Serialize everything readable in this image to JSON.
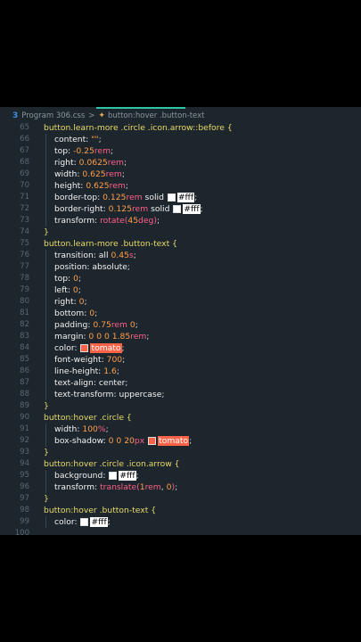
{
  "breadcrumb": {
    "file": "Program 306.css",
    "selector": "button:hover .button-text",
    "separator": ">"
  },
  "colors": {
    "white": "#ffffff",
    "tomato": "#ff6347"
  },
  "lines": [
    {
      "n": "65",
      "segs": [
        {
          "c": "sel",
          "t": "button.learn-more .circle .icon.arrow::before "
        },
        {
          "c": "brace",
          "t": "{"
        }
      ]
    },
    {
      "n": "66",
      "ind": 1,
      "segs": [
        {
          "c": "prop",
          "t": "content: "
        },
        {
          "c": "num",
          "t": "\"\""
        },
        {
          "c": "punc",
          "t": ";"
        }
      ]
    },
    {
      "n": "67",
      "ind": 1,
      "segs": [
        {
          "c": "prop",
          "t": "top: "
        },
        {
          "c": "num",
          "t": "-0.25"
        },
        {
          "c": "unit",
          "t": "rem"
        },
        {
          "c": "punc",
          "t": ";"
        }
      ]
    },
    {
      "n": "68",
      "ind": 1,
      "segs": [
        {
          "c": "prop",
          "t": "right: "
        },
        {
          "c": "num",
          "t": "0.0625"
        },
        {
          "c": "unit",
          "t": "rem"
        },
        {
          "c": "punc",
          "t": ";"
        }
      ]
    },
    {
      "n": "69",
      "ind": 1,
      "segs": [
        {
          "c": "prop",
          "t": "width: "
        },
        {
          "c": "num",
          "t": "0.625"
        },
        {
          "c": "unit",
          "t": "rem"
        },
        {
          "c": "punc",
          "t": ";"
        }
      ]
    },
    {
      "n": "70",
      "ind": 1,
      "segs": [
        {
          "c": "prop",
          "t": "height: "
        },
        {
          "c": "num",
          "t": "0.625"
        },
        {
          "c": "unit",
          "t": "rem"
        },
        {
          "c": "punc",
          "t": ";"
        }
      ]
    },
    {
      "n": "71",
      "ind": 1,
      "segs": [
        {
          "c": "prop",
          "t": "border-top: "
        },
        {
          "c": "num",
          "t": "0.125"
        },
        {
          "c": "unit",
          "t": "rem"
        },
        {
          "c": "kw",
          "t": " solid "
        },
        {
          "sw": "white"
        },
        {
          "c": "chip-white",
          "t": "#fff"
        },
        {
          "c": "punc",
          "t": ";"
        }
      ]
    },
    {
      "n": "72",
      "ind": 1,
      "segs": [
        {
          "c": "prop",
          "t": "border-right: "
        },
        {
          "c": "num",
          "t": "0.125"
        },
        {
          "c": "unit",
          "t": "rem"
        },
        {
          "c": "kw",
          "t": " solid "
        },
        {
          "sw": "white"
        },
        {
          "c": "chip-white",
          "t": "#fff"
        },
        {
          "c": "punc",
          "t": ";"
        }
      ]
    },
    {
      "n": "73",
      "ind": 1,
      "segs": [
        {
          "c": "prop",
          "t": "transform: "
        },
        {
          "c": "fn",
          "t": "rotate("
        },
        {
          "c": "num",
          "t": "45"
        },
        {
          "c": "unit",
          "t": "deg"
        },
        {
          "c": "fn",
          "t": ")"
        },
        {
          "c": "punc",
          "t": ";"
        }
      ]
    },
    {
      "n": "74",
      "segs": [
        {
          "c": "brace",
          "t": "}"
        }
      ]
    },
    {
      "n": "75",
      "segs": [
        {
          "c": "sel",
          "t": "button.learn-more .button-text "
        },
        {
          "c": "brace",
          "t": "{"
        }
      ]
    },
    {
      "n": "76",
      "ind": 1,
      "segs": [
        {
          "c": "prop",
          "t": "transition: "
        },
        {
          "c": "kw",
          "t": "all "
        },
        {
          "c": "num",
          "t": "0.45"
        },
        {
          "c": "unit",
          "t": "s"
        },
        {
          "c": "punc",
          "t": ";"
        }
      ]
    },
    {
      "n": "77",
      "ind": 1,
      "segs": [
        {
          "c": "prop",
          "t": "position: "
        },
        {
          "c": "kw",
          "t": "absolute"
        },
        {
          "c": "punc",
          "t": ";"
        }
      ]
    },
    {
      "n": "78",
      "ind": 1,
      "segs": [
        {
          "c": "prop",
          "t": "top: "
        },
        {
          "c": "num",
          "t": "0"
        },
        {
          "c": "punc",
          "t": ";"
        }
      ]
    },
    {
      "n": "79",
      "ind": 1,
      "segs": [
        {
          "c": "prop",
          "t": "left: "
        },
        {
          "c": "num",
          "t": "0"
        },
        {
          "c": "punc",
          "t": ";"
        }
      ]
    },
    {
      "n": "80",
      "ind": 1,
      "segs": [
        {
          "c": "prop",
          "t": "right: "
        },
        {
          "c": "num",
          "t": "0"
        },
        {
          "c": "punc",
          "t": ";"
        }
      ]
    },
    {
      "n": "81",
      "ind": 1,
      "segs": [
        {
          "c": "prop",
          "t": "bottom: "
        },
        {
          "c": "num",
          "t": "0"
        },
        {
          "c": "punc",
          "t": ";"
        }
      ]
    },
    {
      "n": "82",
      "ind": 1,
      "segs": [
        {
          "c": "prop",
          "t": "padding: "
        },
        {
          "c": "num",
          "t": "0.75"
        },
        {
          "c": "unit",
          "t": "rem"
        },
        {
          "c": "num",
          "t": " 0"
        },
        {
          "c": "punc",
          "t": ";"
        }
      ]
    },
    {
      "n": "83",
      "ind": 1,
      "segs": [
        {
          "c": "prop",
          "t": "margin: "
        },
        {
          "c": "num",
          "t": "0 0 0 1.85"
        },
        {
          "c": "unit",
          "t": "rem"
        },
        {
          "c": "punc",
          "t": ";"
        }
      ]
    },
    {
      "n": "84",
      "ind": 1,
      "segs": [
        {
          "c": "prop",
          "t": "color: "
        },
        {
          "sw": "tomato"
        },
        {
          "c": "chip-tomato",
          "t": "tomato"
        },
        {
          "c": "punc",
          "t": ";"
        }
      ]
    },
    {
      "n": "85",
      "ind": 1,
      "segs": [
        {
          "c": "prop",
          "t": "font-weight: "
        },
        {
          "c": "num",
          "t": "700"
        },
        {
          "c": "punc",
          "t": ";"
        }
      ]
    },
    {
      "n": "86",
      "ind": 1,
      "segs": [
        {
          "c": "prop",
          "t": "line-height: "
        },
        {
          "c": "num",
          "t": "1.6"
        },
        {
          "c": "punc",
          "t": ";"
        }
      ]
    },
    {
      "n": "87",
      "ind": 1,
      "segs": [
        {
          "c": "prop",
          "t": "text-align: "
        },
        {
          "c": "kw",
          "t": "center"
        },
        {
          "c": "punc",
          "t": ";"
        }
      ]
    },
    {
      "n": "88",
      "ind": 1,
      "segs": [
        {
          "c": "prop",
          "t": "text-transform: "
        },
        {
          "c": "kw",
          "t": "uppercase"
        },
        {
          "c": "punc",
          "t": ";"
        }
      ]
    },
    {
      "n": "89",
      "segs": [
        {
          "c": "brace",
          "t": "}"
        }
      ]
    },
    {
      "n": "90",
      "segs": [
        {
          "c": "sel",
          "t": "button:hover .circle "
        },
        {
          "c": "brace",
          "t": "{"
        }
      ]
    },
    {
      "n": "91",
      "ind": 1,
      "segs": [
        {
          "c": "prop",
          "t": "width: "
        },
        {
          "c": "num",
          "t": "100"
        },
        {
          "c": "unit",
          "t": "%"
        },
        {
          "c": "punc",
          "t": ";"
        }
      ]
    },
    {
      "n": "92",
      "ind": 1,
      "segs": [
        {
          "c": "prop",
          "t": "box-shadow: "
        },
        {
          "c": "num",
          "t": "0 0 20"
        },
        {
          "c": "unit",
          "t": "px"
        },
        {
          "c": "kw",
          "t": " "
        },
        {
          "sw": "tomato"
        },
        {
          "c": "chip-tomato",
          "t": "tomato"
        },
        {
          "c": "punc",
          "t": ";"
        }
      ]
    },
    {
      "n": "93",
      "segs": [
        {
          "c": "brace",
          "t": "}"
        }
      ]
    },
    {
      "n": "94",
      "segs": [
        {
          "c": "sel",
          "t": "button:hover .circle .icon.arrow "
        },
        {
          "c": "brace",
          "t": "{"
        }
      ]
    },
    {
      "n": "95",
      "ind": 1,
      "segs": [
        {
          "c": "prop",
          "t": "background: "
        },
        {
          "sw": "white"
        },
        {
          "c": "chip-white",
          "t": "#fff"
        },
        {
          "c": "punc",
          "t": ";"
        }
      ]
    },
    {
      "n": "96",
      "ind": 1,
      "segs": [
        {
          "c": "prop",
          "t": "transform: "
        },
        {
          "c": "fn",
          "t": "translate("
        },
        {
          "c": "num",
          "t": "1"
        },
        {
          "c": "unit",
          "t": "rem"
        },
        {
          "c": "punc",
          "t": ", "
        },
        {
          "c": "num",
          "t": "0"
        },
        {
          "c": "fn",
          "t": ")"
        },
        {
          "c": "punc",
          "t": ";"
        }
      ]
    },
    {
      "n": "97",
      "segs": [
        {
          "c": "brace",
          "t": "}"
        }
      ]
    },
    {
      "n": "98",
      "segs": [
        {
          "c": "sel",
          "t": "button:hover .button-text "
        },
        {
          "c": "brace",
          "t": "{"
        }
      ]
    },
    {
      "n": "99",
      "ind": 1,
      "segs": [
        {
          "c": "prop",
          "t": "color: "
        },
        {
          "sw": "white"
        },
        {
          "c": "chip-white",
          "t": "#fff"
        },
        {
          "c": "punc",
          "t": ";"
        }
      ]
    },
    {
      "n": "100",
      "segs": []
    }
  ]
}
